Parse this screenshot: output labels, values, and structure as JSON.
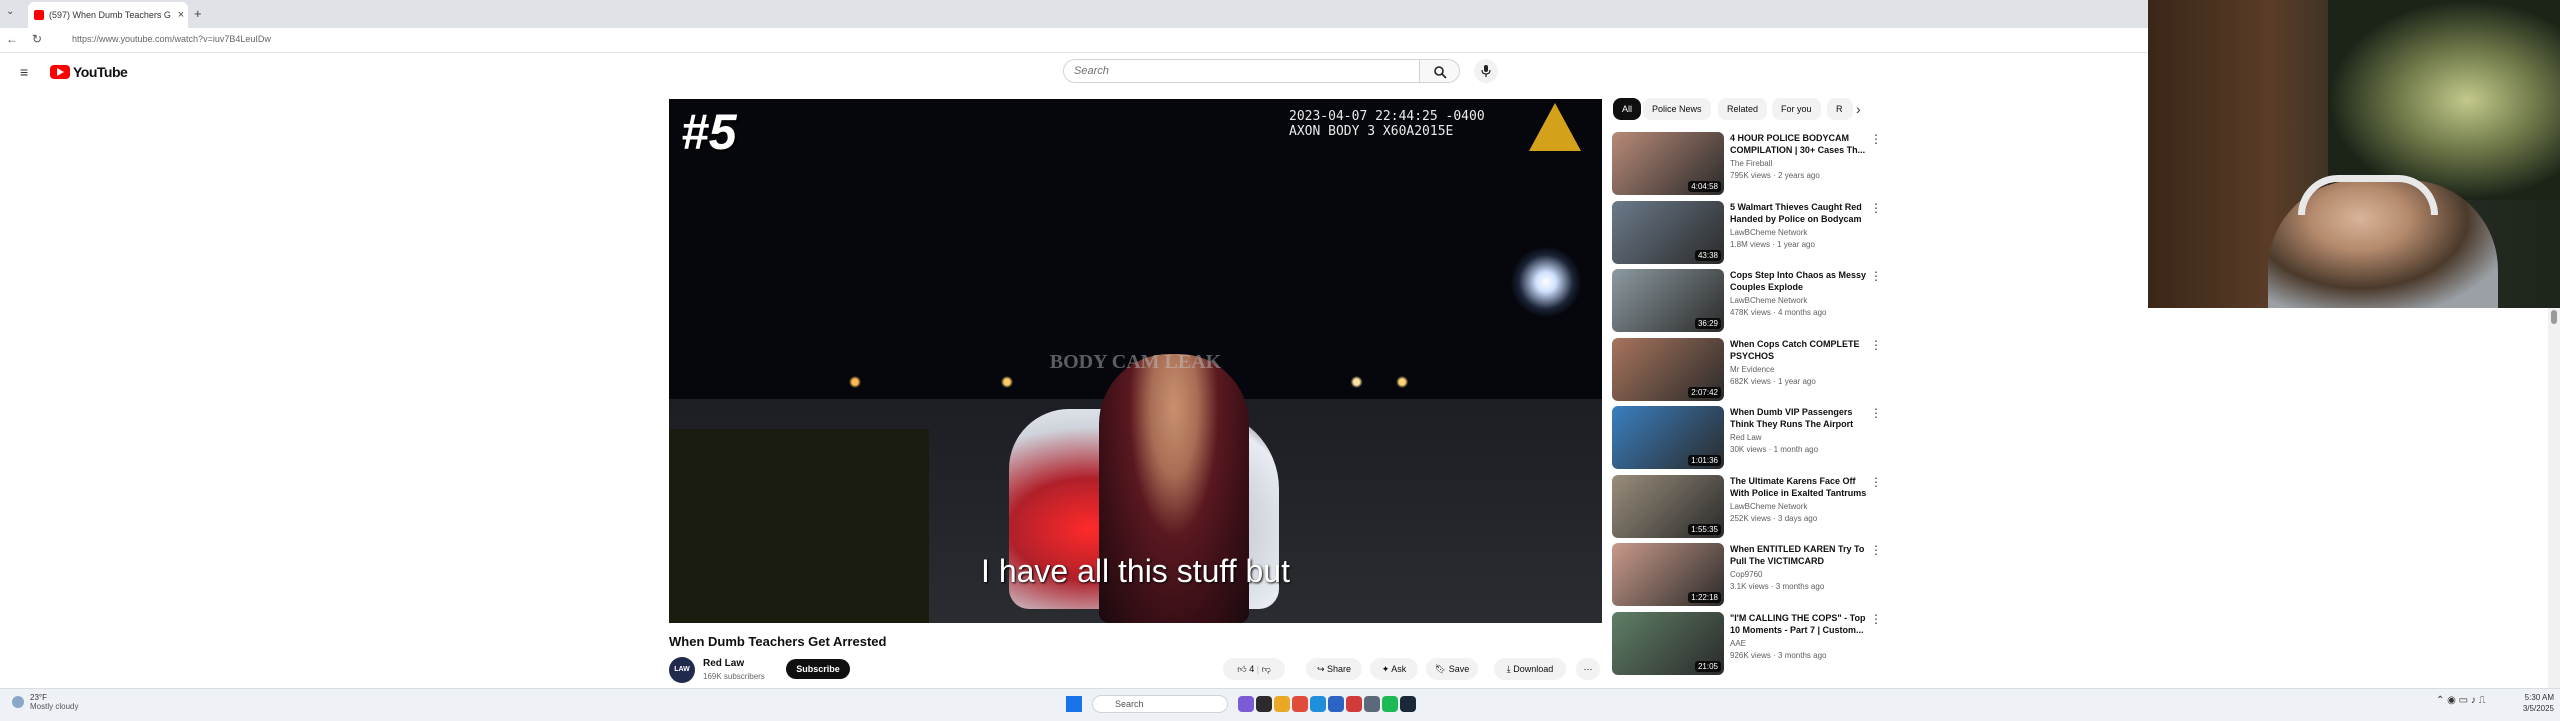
{
  "browser": {
    "tab_title": "(597) When Dumb Teachers G",
    "tab_close": "×",
    "new_tab": "+",
    "url": "https://www.youtube.com/watch?v=iuv7B4LeuIDw"
  },
  "youtube": {
    "logo_text": "YouTube",
    "search_placeholder": "Search"
  },
  "player": {
    "badge": "#5",
    "timestamp_line1": "2023-04-07 22:44:25 -0400",
    "timestamp_line2": "AXON BODY 3 X60A2015E",
    "watermark": "BODY CAM LEAK",
    "caption": "I have all this stuff but"
  },
  "video": {
    "title": "When Dumb Teachers Get Arrested",
    "channel": "Red Law",
    "subscribers": "169K subscribers",
    "subscribe_label": "Subscribe",
    "like_count": "4",
    "share_label": "Share",
    "ask_label": "Ask",
    "save_label": "Save",
    "download_label": "Download",
    "avatar_text": "LAW"
  },
  "chips": [
    "All",
    "Police News",
    "Related",
    "For you",
    "R"
  ],
  "recommendations": [
    {
      "title": "4 HOUR POLICE BODYCAM COMPILATION | 30+ Cases Th...",
      "channel": "The Fireball",
      "meta": "795K views · 2 years ago",
      "duration": "4:04:58",
      "color": "#b88a78"
    },
    {
      "title": "5 Walmart Thieves Caught Red Handed by Police on Bodycam",
      "channel": "LawBCheme Network",
      "meta": "1.8M views · 1 year ago",
      "duration": "43:38",
      "color": "#6b7a8a"
    },
    {
      "title": "Cops Step Into Chaos as Messy Couples Explode",
      "channel": "LawBCheme Network",
      "meta": "478K views · 4 months ago",
      "duration": "36:29",
      "color": "#8c9aa0"
    },
    {
      "title": "When Cops Catch COMPLETE PSYCHOS",
      "channel": "Mr Evidence",
      "meta": "682K views · 1 year ago",
      "duration": "2:07:42",
      "color": "#a8745c"
    },
    {
      "title": "When Dumb VIP Passengers Think They Runs The Airport",
      "channel": "Red Law",
      "meta": "30K views · 1 month ago",
      "duration": "1:01:36",
      "color": "#3a7fc0"
    },
    {
      "title": "The Ultimate Karens Face Off With Police in Exalted Tantrums",
      "channel": "LawBCheme Network",
      "meta": "252K views · 3 days ago",
      "duration": "1:55:35",
      "color": "#9a8e7c"
    },
    {
      "title": "When ENTITLED KAREN Try To Pull The VICTIMCARD",
      "channel": "Cop9760",
      "meta": "3.1K views · 3 months ago",
      "duration": "1:22:18",
      "color": "#c99a8a"
    },
    {
      "title": "\"I'M CALLING THE COPS\" - Top 10 Moments - Part 7 | Custom...",
      "channel": "AAE",
      "meta": "926K views · 3 months ago",
      "duration": "21:05",
      "color": "#5f7f66"
    }
  ],
  "taskbar": {
    "weather_temp": "23°F",
    "weather_desc": "Mostly cloudy",
    "search_placeholder": "Search",
    "time": "5:30 AM",
    "date": "3/5/2025"
  },
  "colors": {
    "yt_red": "#ff0000",
    "chip_active_bg": "#0f0f0f",
    "subscribe_bg": "#0f0f0f",
    "axon_logo": "#d4a21a"
  }
}
